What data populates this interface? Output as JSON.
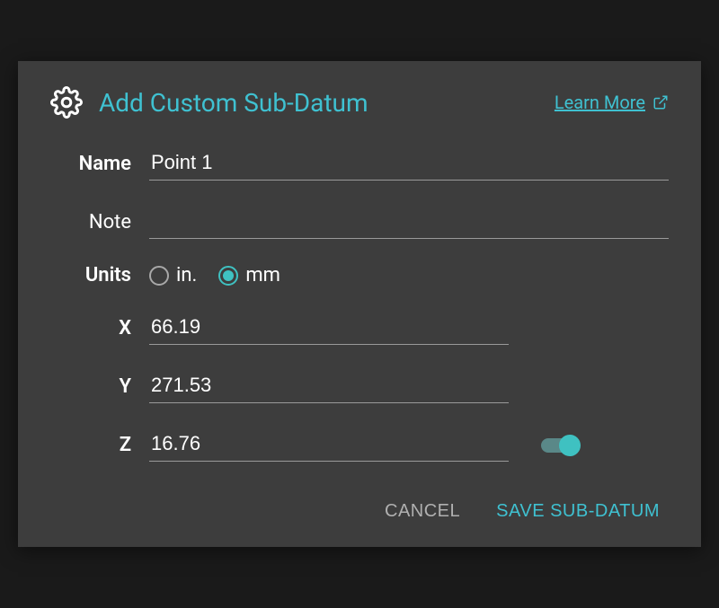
{
  "header": {
    "title": "Add Custom Sub-Datum",
    "learn_more": "Learn More"
  },
  "form": {
    "name_label": "Name",
    "name_value": "Point 1",
    "note_label": "Note",
    "note_value": "",
    "units_label": "Units",
    "unit_in": "in.",
    "unit_mm": "mm",
    "unit_selected": "mm",
    "x_label": "X",
    "x_value": "66.19",
    "y_label": "Y",
    "y_value": "271.53",
    "z_label": "Z",
    "z_value": "16.76",
    "z_toggle": true
  },
  "actions": {
    "cancel": "CANCEL",
    "save": "SAVE SUB-DATUM"
  },
  "colors": {
    "accent": "#3fc1d1",
    "background": "#3d3d3d"
  }
}
